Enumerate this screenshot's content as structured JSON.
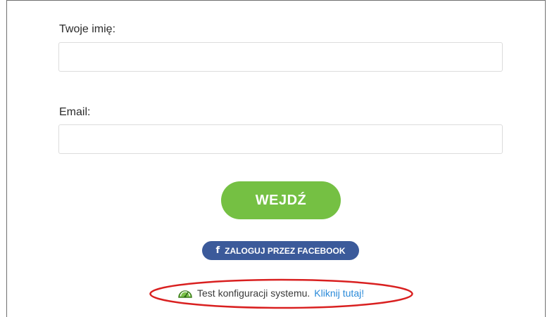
{
  "form": {
    "name_label": "Twoje imię:",
    "name_value": "",
    "name_placeholder": "",
    "email_label": "Email:",
    "email_value": "",
    "email_placeholder": "",
    "enter_label": "WEJDŹ",
    "facebook_label": "ZALOGUJ PRZEZ FACEBOOK",
    "facebook_icon_glyph": "f"
  },
  "system_test": {
    "text": "Test konfiguracji systemu.",
    "link_text": "Kliknij tutaj!",
    "icon": "speedometer-icon"
  },
  "colors": {
    "enter_button": "#75c043",
    "facebook_button": "#3b5a9a",
    "link": "#2a8ad9",
    "annotation_ellipse": "#d92020"
  }
}
